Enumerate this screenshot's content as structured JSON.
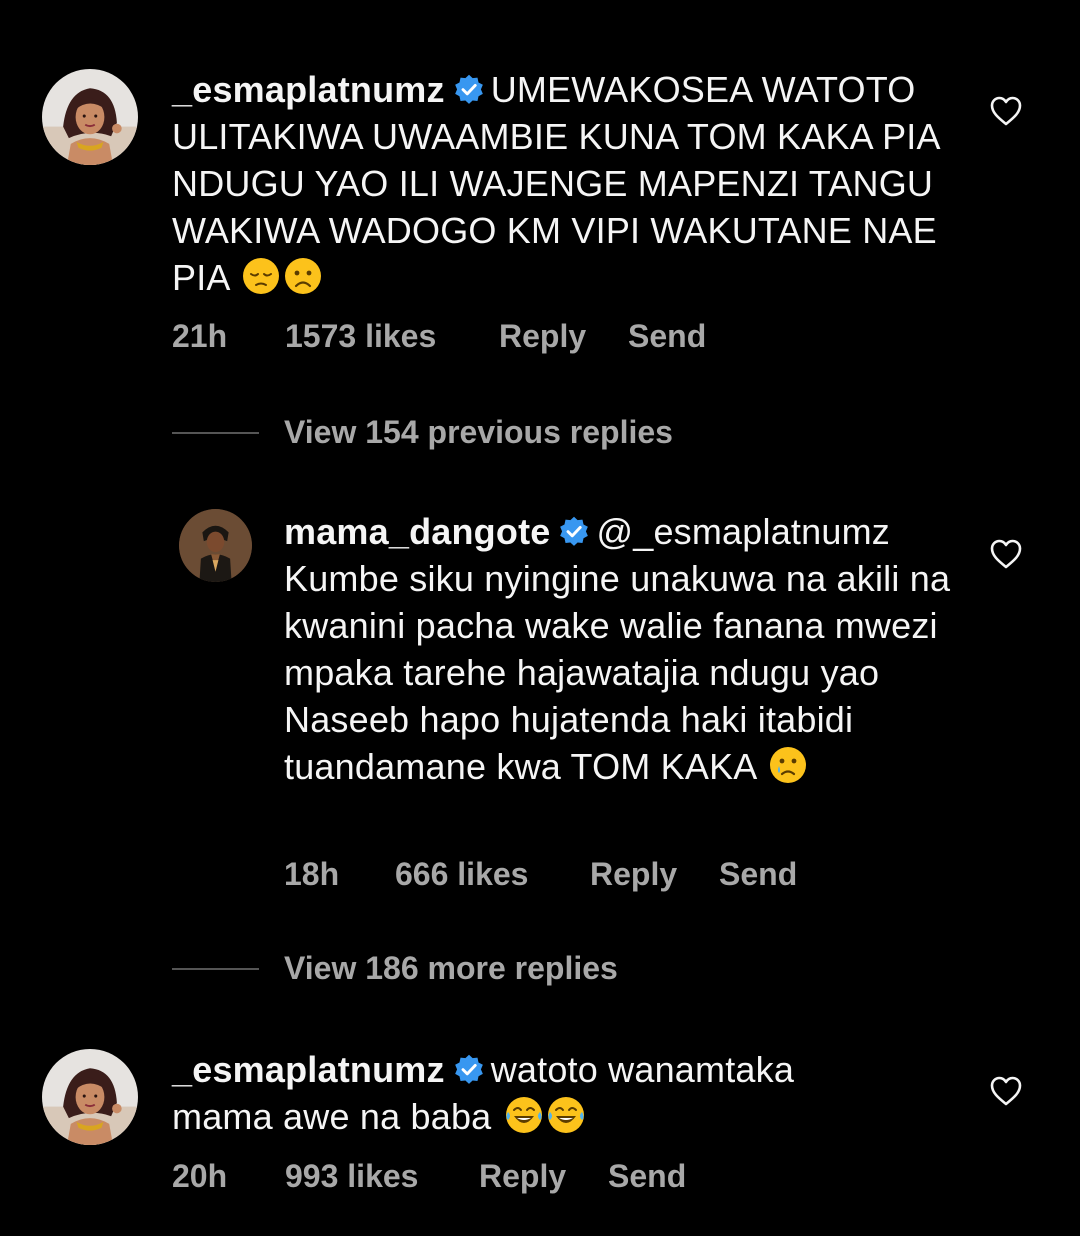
{
  "comments": [
    {
      "username": "_esmaplatnumz",
      "text": "UMEWAKOSEA WATOTO ULITAKIWA UWAAMBIE KUNA TOM KAKA PIA NDUGU YAO ILI WAJENGE MAPENZI TANGU WAKIWA WADOGO KM VIPI WAKUTANE NAE PIA",
      "emojis": [
        "😔",
        "☹️"
      ],
      "time": "21h",
      "likes": "1573 likes",
      "reply": "Reply",
      "send": "Send"
    },
    {
      "username": "mama_dangote",
      "mention": "@_esmaplatnumz",
      "text": "Kumbe siku nyingine unakuwa na akili na kwanini pacha wake walie fanana mwezi mpaka tarehe hajawatajia ndugu yao Naseeb hapo hujatenda haki itabidi tuandamane kwa TOM KAKA",
      "emojis": [
        "😢"
      ],
      "time": "18h",
      "likes": "666 likes",
      "reply": "Reply",
      "send": "Send"
    },
    {
      "username": "_esmaplatnumz",
      "text": "watoto wanamtaka mama awe na baba",
      "emojis": [
        "😂",
        "😂"
      ],
      "time": "20h",
      "likes": "993 likes",
      "reply": "Reply",
      "send": "Send"
    }
  ],
  "view_previous": "View 154 previous replies",
  "view_more": "View 186 more replies",
  "icons": {
    "verified": "verified-badge-icon",
    "like": "heart-outline-icon"
  },
  "colors": {
    "background": "#000000",
    "text": "#f5f5f5",
    "secondary": "#a8a8a8",
    "verified": "#3897f0"
  }
}
